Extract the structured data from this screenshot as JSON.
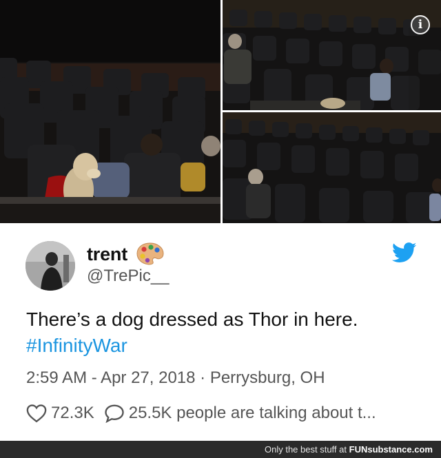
{
  "photos": {
    "main_alt": "dog in a red cape in a movie theater",
    "top_right_alt": "theater seats with dog on floor",
    "bottom_right_alt": "theater seats with audience",
    "info_symbol": "i"
  },
  "tweet": {
    "display_name": "trent",
    "handle": "@TrePic__",
    "text_line": "There’s a dog dressed as Thor in here.",
    "hashtag": "#InfinityWar",
    "timestamp": "2:59 AM - Apr 27, 2018 · Perrysburg, OH",
    "likes": "72.3K",
    "talking": "25.5K people are talking about t...",
    "accent_color": "#1b95e0",
    "icons": [
      "palette-emoji",
      "twitter-bird-icon",
      "heart-icon",
      "comment-bubble-icon",
      "info-icon"
    ]
  },
  "footer": {
    "prefix": "Only the best stuff at",
    "logo": "FUNsubstance.com"
  }
}
